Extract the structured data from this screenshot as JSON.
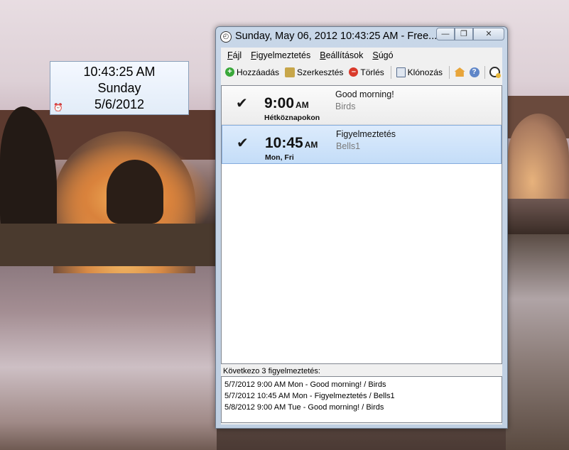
{
  "widget": {
    "time": "10:43:25 AM",
    "day": "Sunday",
    "date": "5/6/2012"
  },
  "window": {
    "title": "Sunday, May 06, 2012 10:43:25 AM - Free...",
    "buttons": {
      "minimize": "—",
      "maximize": "❐",
      "close": "✕"
    }
  },
  "menu": {
    "items": [
      {
        "key": "F",
        "rest": "ájl"
      },
      {
        "key": "F",
        "rest": "igyelmeztetés"
      },
      {
        "key": "B",
        "rest": "eállítások"
      },
      {
        "key": "S",
        "rest": "úgó"
      }
    ]
  },
  "toolbar": {
    "add": "Hozzáadás",
    "edit": "Szerkesztés",
    "delete": "Törlés",
    "clone": "Klónozás"
  },
  "alarms": [
    {
      "time": "9:00",
      "ampm": "AM",
      "days": "Hétköznapokon",
      "title": "Good morning!",
      "sound": "Birds",
      "checked": true
    },
    {
      "time": "10:45",
      "ampm": "AM",
      "days": "Mon, Fri",
      "title": "Figyelmeztetés",
      "sound": "Bells1",
      "checked": true
    }
  ],
  "next": {
    "label": "Következo 3 figyelmeztetés:",
    "items": [
      "5/7/2012 9:00 AM Mon - Good morning! / Birds",
      "5/7/2012 10:45 AM Mon - Figyelmeztetés / Bells1",
      "5/8/2012 9:00 AM Tue - Good morning! / Birds"
    ]
  }
}
